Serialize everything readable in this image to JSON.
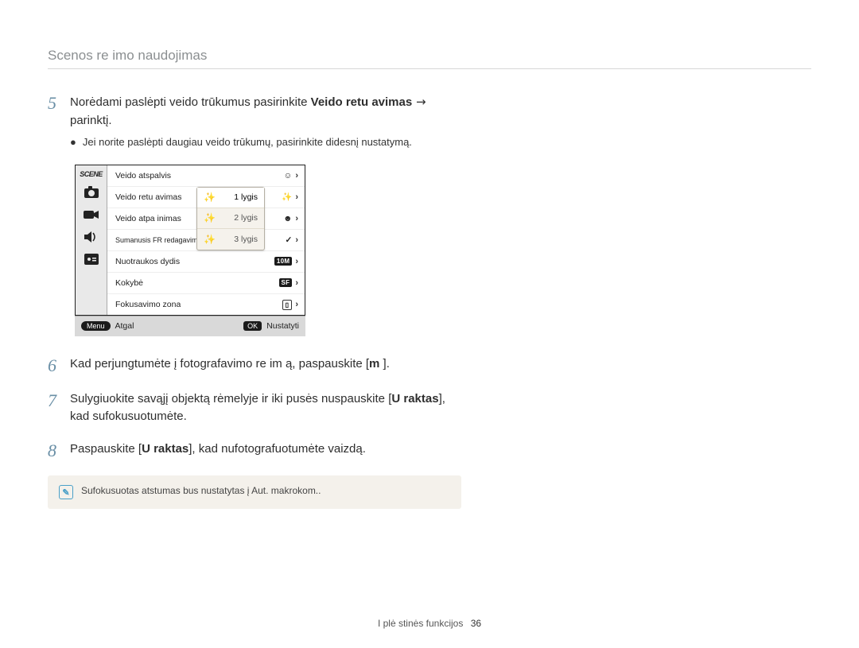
{
  "header": {
    "title": "Scenos re imo naudojimas"
  },
  "steps": [
    {
      "num": "5",
      "text_1": "Norėdami paslėpti veido trūkumus pasirinkite ",
      "bold_1": "Veido retu avimas",
      "arrow": " → ",
      "text_2": "parinktį.",
      "bullet": "Jei norite paslėpti daugiau veido trūkumų, pasirinkite didesnį nustatymą."
    },
    {
      "num": "6",
      "text_1": "Kad perjungtumėte į fotografavimo re im ą, paspauskite [",
      "bold_1": "m",
      "text_2": "        ]."
    },
    {
      "num": "7",
      "text_1": "Sulygiuokite savąjį objektą rėmelyje ir iki pusės nuspauskite [",
      "bold_1": "U raktas",
      "text_2": "], kad sufokusuotumėte."
    },
    {
      "num": "8",
      "text_1": "Paspauskite [",
      "bold_1": "U raktas",
      "text_2": "], kad nufotografuotumėte vaizdą."
    }
  ],
  "menu": {
    "left_icons": {
      "scene": "SCENE",
      "camera": "camera-icon",
      "video": "video-icon",
      "sound": "sound-icon",
      "other": "other-icon"
    },
    "rows": [
      {
        "label": "Veido atspalvis",
        "value_icon": "face-tone-icon",
        "has_chev": true
      },
      {
        "label": "Veido retu avimas",
        "value_icon": "face-retouch-icon",
        "has_chev": true,
        "selected": true
      },
      {
        "label": "Veido atpa inimas",
        "value_icon": "face-recog-icon",
        "has_chev": true
      },
      {
        "label": "Sumanusis FR redagavimas",
        "value_icon": "check-icon",
        "has_chev": true,
        "small": true
      },
      {
        "label": "Nuotraukos dydis",
        "value_text": "10M",
        "has_chev": true
      },
      {
        "label": "Kokybė",
        "value_icon": "quality-icon",
        "has_chev": true
      },
      {
        "label": "Fokusavimo zona",
        "value_icon": "focus-zone-icon",
        "has_chev": true
      }
    ],
    "submenu": [
      {
        "label": "1 lygis",
        "active": true
      },
      {
        "label": "2 lygis"
      },
      {
        "label": "3 lygis"
      }
    ],
    "bottom": {
      "menu_pill": "Menu",
      "back": "Atgal",
      "ok_pill": "OK",
      "set": "Nustatyti"
    }
  },
  "note": {
    "text": "Sufokusuotas atstumas bus nustatytas į Aut. makrokom.."
  },
  "footer": {
    "label": "I plė stinės funkcijos",
    "page": "36"
  }
}
